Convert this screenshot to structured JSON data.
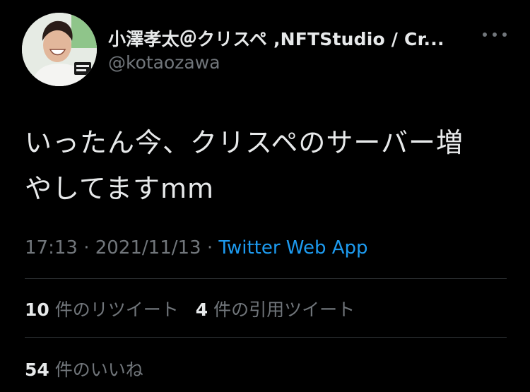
{
  "tweet": {
    "author": {
      "display_name": "小澤孝太＠クリスペ ,NFTStudio / Cr...",
      "handle": "@kotaozawa"
    },
    "text_line1": "いったん今、クリスペのサーバー増",
    "text_line2": "やしてますmm",
    "time": "17:13",
    "date": "2021/11/13",
    "separator": "·",
    "source": "Twitter Web App",
    "stats": {
      "retweets": {
        "count": "10",
        "label": "件のリツイート"
      },
      "quotes": {
        "count": "4",
        "label": "件の引用ツイート"
      },
      "likes": {
        "count": "54",
        "label": "件のいいね"
      }
    }
  },
  "icons": {
    "more": "more-horizontal-icon"
  },
  "colors": {
    "background": "#000000",
    "primary_text": "#e7e9ea",
    "secondary_text": "#71767b",
    "link": "#1d9bf0",
    "divider": "#2f3336"
  }
}
